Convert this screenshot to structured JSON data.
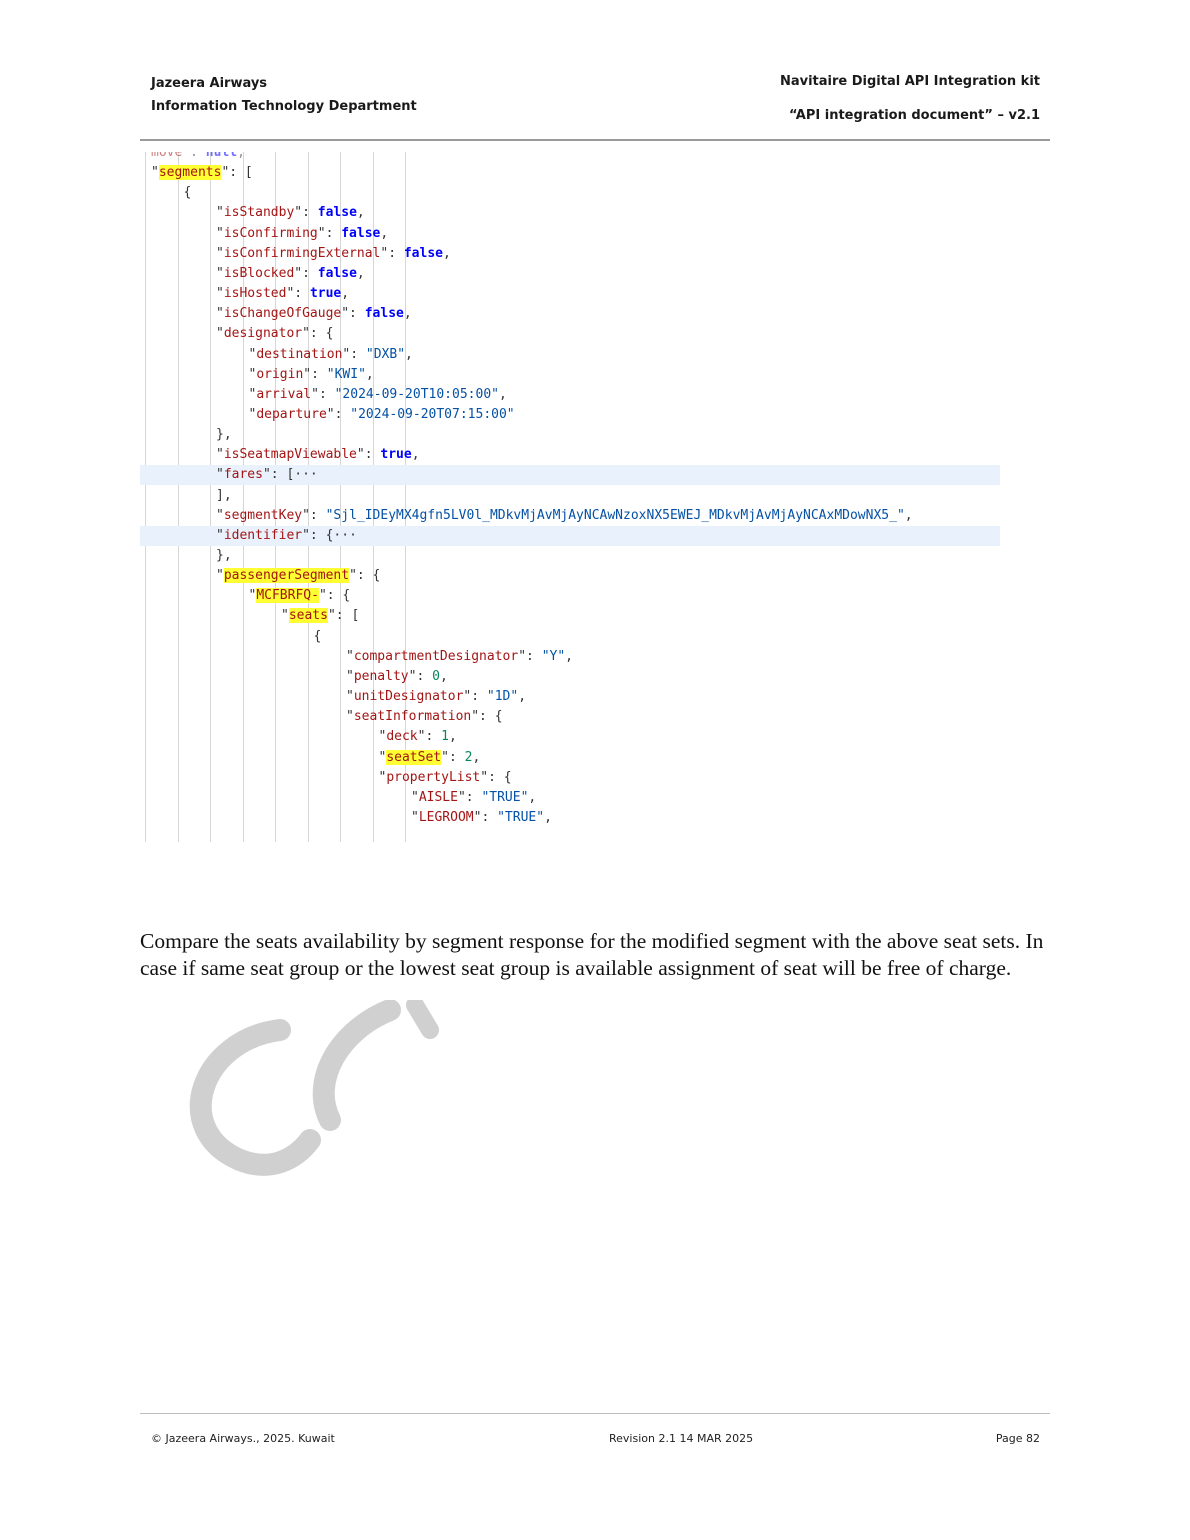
{
  "header": {
    "company": "Jazeera Airways",
    "department": "Information Technology Department",
    "kit_title": "Navitaire Digital API Integration kit",
    "doc_title": "“API integration document” – v2.1"
  },
  "code_lines": [
    {
      "indent": 2,
      "tokens": [
        [
          "k",
          "move"
        ],
        [
          "p",
          " : "
        ],
        [
          "b",
          "null"
        ],
        [
          "p",
          ","
        ]
      ]
    },
    {
      "indent": 2,
      "tokens": [
        [
          "p",
          "\""
        ],
        [
          "k",
          "segments"
        ],
        [
          "p",
          "\": ["
        ]
      ]
    },
    {
      "indent": 3,
      "tokens": [
        [
          "p",
          "{"
        ]
      ]
    },
    {
      "indent": 4,
      "tokens": [
        [
          "p",
          "\""
        ],
        [
          "k",
          "isStandby"
        ],
        [
          "p",
          "\": "
        ],
        [
          "b",
          "false"
        ],
        [
          "p",
          ","
        ]
      ]
    },
    {
      "indent": 4,
      "tokens": [
        [
          "p",
          "\""
        ],
        [
          "k",
          "isConfirming"
        ],
        [
          "p",
          "\": "
        ],
        [
          "b",
          "false"
        ],
        [
          "p",
          ","
        ]
      ]
    },
    {
      "indent": 4,
      "tokens": [
        [
          "p",
          "\""
        ],
        [
          "k",
          "isConfirmingExternal"
        ],
        [
          "p",
          "\": "
        ],
        [
          "b",
          "false"
        ],
        [
          "p",
          ","
        ]
      ]
    },
    {
      "indent": 4,
      "tokens": [
        [
          "p",
          "\""
        ],
        [
          "k",
          "isBlocked"
        ],
        [
          "p",
          "\": "
        ],
        [
          "b",
          "false"
        ],
        [
          "p",
          ","
        ]
      ]
    },
    {
      "indent": 4,
      "tokens": [
        [
          "p",
          "\""
        ],
        [
          "k",
          "isHosted"
        ],
        [
          "p",
          "\": "
        ],
        [
          "b",
          "true"
        ],
        [
          "p",
          ","
        ]
      ]
    },
    {
      "indent": 4,
      "tokens": [
        [
          "p",
          "\""
        ],
        [
          "k",
          "isChangeOfGauge"
        ],
        [
          "p",
          "\": "
        ],
        [
          "b",
          "false"
        ],
        [
          "p",
          ","
        ]
      ]
    },
    {
      "indent": 4,
      "tokens": [
        [
          "p",
          "\""
        ],
        [
          "k",
          "designator"
        ],
        [
          "p",
          "\": {"
        ]
      ]
    },
    {
      "indent": 5,
      "tokens": [
        [
          "p",
          "\""
        ],
        [
          "k",
          "destination"
        ],
        [
          "p",
          "\": "
        ],
        [
          "s",
          "\"DXB\""
        ],
        [
          "p",
          ","
        ]
      ]
    },
    {
      "indent": 5,
      "tokens": [
        [
          "p",
          "\""
        ],
        [
          "k",
          "origin"
        ],
        [
          "p",
          "\": "
        ],
        [
          "s",
          "\"KWI\""
        ],
        [
          "p",
          ","
        ]
      ]
    },
    {
      "indent": 5,
      "tokens": [
        [
          "p",
          "\""
        ],
        [
          "k",
          "arrival"
        ],
        [
          "p",
          "\": "
        ],
        [
          "s",
          "\"2024-09-20T10:05:00\""
        ],
        [
          "p",
          ","
        ]
      ]
    },
    {
      "indent": 5,
      "tokens": [
        [
          "p",
          "\""
        ],
        [
          "k",
          "departure"
        ],
        [
          "p",
          "\": "
        ],
        [
          "s",
          "\"2024-09-20T07:15:00\""
        ]
      ]
    },
    {
      "indent": 4,
      "tokens": [
        [
          "p",
          "},"
        ]
      ]
    },
    {
      "indent": 4,
      "tokens": [
        [
          "p",
          "\""
        ],
        [
          "k",
          "isSeatmapViewable"
        ],
        [
          "p",
          "\": "
        ],
        [
          "b",
          "true"
        ],
        [
          "p",
          ","
        ]
      ]
    },
    {
      "indent": 4,
      "tokens": [
        [
          "p",
          "\""
        ],
        [
          "k",
          "fares"
        ],
        [
          "p",
          "\": [···"
        ]
      ]
    },
    {
      "indent": 4,
      "tokens": [
        [
          "p",
          "],"
        ]
      ]
    },
    {
      "indent": 4,
      "tokens": [
        [
          "p",
          "\""
        ],
        [
          "k",
          "segmentKey"
        ],
        [
          "p",
          "\": "
        ],
        [
          "s",
          "\"Sjl_IDEyMX4gfn5LV0l_MDkvMjAvMjAyNCAwNzoxNX5EWEJ_MDkvMjAvMjAyNCAxMDowNX5_\""
        ],
        [
          "p",
          ","
        ]
      ]
    },
    {
      "indent": 4,
      "tokens": [
        [
          "p",
          "\""
        ],
        [
          "k",
          "identifier"
        ],
        [
          "p",
          "\": {···"
        ]
      ]
    },
    {
      "indent": 4,
      "tokens": [
        [
          "p",
          "},"
        ]
      ]
    },
    {
      "indent": 4,
      "tokens": [
        [
          "p",
          "\""
        ],
        [
          "k",
          "passengerSegment"
        ],
        [
          "p",
          "\": {"
        ]
      ]
    },
    {
      "indent": 5,
      "tokens": [
        [
          "p",
          "\""
        ],
        [
          "k",
          "MCFBRFQ-"
        ],
        [
          "p",
          "\": {"
        ]
      ]
    },
    {
      "indent": 6,
      "tokens": [
        [
          "p",
          "\""
        ],
        [
          "k",
          "seats"
        ],
        [
          "p",
          "\": ["
        ]
      ]
    },
    {
      "indent": 7,
      "tokens": [
        [
          "p",
          "{"
        ]
      ]
    },
    {
      "indent": 8,
      "tokens": [
        [
          "p",
          "\""
        ],
        [
          "k",
          "compartmentDesignator"
        ],
        [
          "p",
          "\": "
        ],
        [
          "s",
          "\"Y\""
        ],
        [
          "p",
          ","
        ]
      ]
    },
    {
      "indent": 8,
      "tokens": [
        [
          "p",
          "\""
        ],
        [
          "k",
          "penalty"
        ],
        [
          "p",
          "\": "
        ],
        [
          "n",
          "0"
        ],
        [
          "p",
          ","
        ]
      ]
    },
    {
      "indent": 8,
      "tokens": [
        [
          "p",
          "\""
        ],
        [
          "k",
          "unitDesignator"
        ],
        [
          "p",
          "\": "
        ],
        [
          "s",
          "\"1D\""
        ],
        [
          "p",
          ","
        ]
      ]
    },
    {
      "indent": 8,
      "tokens": [
        [
          "p",
          "\""
        ],
        [
          "k",
          "seatInformation"
        ],
        [
          "p",
          "\": {"
        ]
      ]
    },
    {
      "indent": 9,
      "tokens": [
        [
          "p",
          "\""
        ],
        [
          "k",
          "deck"
        ],
        [
          "p",
          "\": "
        ],
        [
          "n",
          "1"
        ],
        [
          "p",
          ","
        ]
      ]
    },
    {
      "indent": 9,
      "tokens": [
        [
          "p",
          "\""
        ],
        [
          "k",
          "seatSet"
        ],
        [
          "p",
          "\": "
        ],
        [
          "n",
          "2"
        ],
        [
          "p",
          ","
        ]
      ]
    },
    {
      "indent": 9,
      "tokens": [
        [
          "p",
          "\""
        ],
        [
          "k",
          "propertyList"
        ],
        [
          "p",
          "\": {"
        ]
      ]
    },
    {
      "indent": 10,
      "tokens": [
        [
          "p",
          "\""
        ],
        [
          "k",
          "AISLE"
        ],
        [
          "p",
          "\": "
        ],
        [
          "s",
          "\"TRUE\""
        ],
        [
          "p",
          ","
        ]
      ]
    },
    {
      "indent": 10,
      "tokens": [
        [
          "p",
          "\""
        ],
        [
          "k",
          "LEGROOM"
        ],
        [
          "p",
          "\": "
        ],
        [
          "s",
          "\"TRUE\""
        ],
        [
          "p",
          ","
        ]
      ]
    }
  ],
  "highlighted_keys": [
    "segments",
    "passengerSegment",
    "MCFBRFQ-",
    "seats",
    "seatSet"
  ],
  "collapsed_rows": [
    "fares",
    "identifier"
  ],
  "paragraph": "Compare the seats availability by segment response for the modified segment with the above seat sets. In case if same seat group or the lowest seat group is available assignment of seat will be free of charge.",
  "footer": {
    "copyright": "© Jazeera Airways., 2025. Kuwait",
    "revision": "Revision 2.1  14 MAR 2025",
    "page": "Page 82"
  },
  "colors": {
    "key": "#a31515",
    "string": "#0451a5",
    "boolean": "#0000ff",
    "number": "#098658",
    "highlight": "#ffff33",
    "collapsed_row_bg": "#e8f1fc",
    "watermark": "#d0d0d0"
  },
  "icons": [
    "watermark-stamp"
  ]
}
